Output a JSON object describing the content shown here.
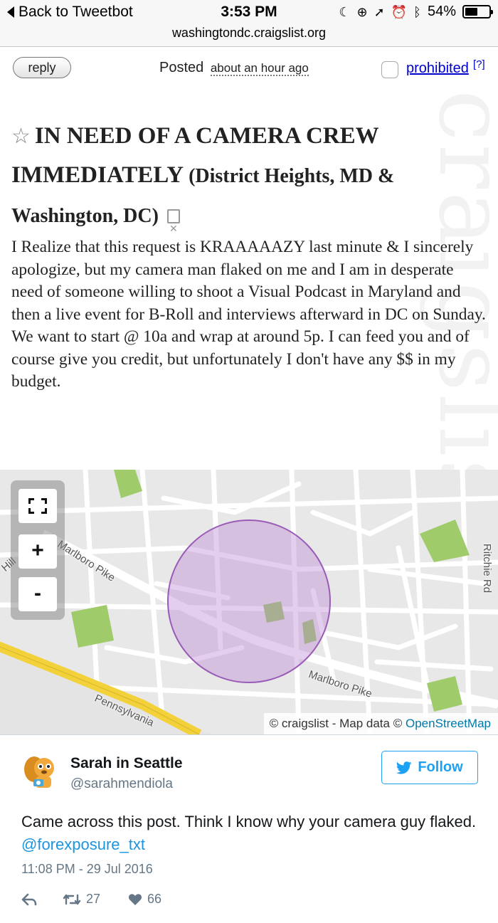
{
  "status_bar": {
    "back_label": "Back to Tweetbot",
    "time": "3:53 PM",
    "battery": "54%",
    "battery_level": 0.54
  },
  "url": "washingtondc.craigslist.org",
  "post": {
    "reply_label": "reply",
    "posted_label": "Posted",
    "posted_ago": "about an hour ago",
    "prohibited_label": "prohibited",
    "help_label": "[?]",
    "title": "IN NEED OF A CAMERA CREW IMMEDIATELY",
    "location": "(District Heights, MD & Washington, DC)",
    "body": "I Realize that this request is KRAAAAAZY last minute & I sincerely apologize, but my camera man flaked on me and I am in desperate need of someone willing to shoot a Visual Podcast in Maryland and then a live event for B-Roll and interviews afterward in DC on Sunday. We want to start @ 10a and wrap at around 5p. I can feed you and of course give you credit, but unfortunately I don't have any $$ in my budget.",
    "watermark": "craigslist"
  },
  "map": {
    "zoom_in": "+",
    "zoom_out": "-",
    "attribution_prefix": "© craigslist - Map data ©",
    "attribution_link": "OpenStreetMap",
    "labels": {
      "marlboro_pike_1": "Marlboro Pike",
      "marlboro_pike_2": "Marlboro Pike",
      "pennsylvania": "Pennsylvania",
      "ritchie": "Ritchie Rd",
      "hill": "Hill"
    },
    "colors": {
      "circle_fill": "#b57fcf",
      "circle_stroke": "#9a5bb8",
      "park": "#9fcb6b",
      "highway": "#f2d13a"
    }
  },
  "tweet": {
    "author": "Sarah in Seattle",
    "handle": "@sarahmendiola",
    "follow_label": "Follow",
    "text_before": "Came across this post. Think I know why your camera guy flaked.",
    "mention": "@forexposure_txt",
    "timestamp": "11:08 PM - 29 Jul 2016",
    "retweets": "27",
    "likes": "66",
    "accent_color": "#1da1f2"
  }
}
